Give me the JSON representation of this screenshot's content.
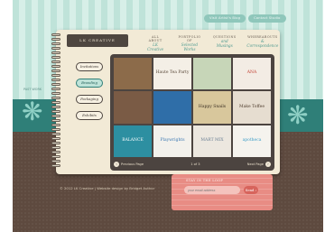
{
  "top_nav": {
    "items": [
      "Visit Artist's Blog",
      "Contact Studio"
    ]
  },
  "brand": {
    "name": "LK CREATIVE"
  },
  "book_nav": [
    {
      "line1": "ALL ABOUT",
      "line2": "LK Creative"
    },
    {
      "line1": "PORTFOLIO OF",
      "line2": "Selected Works"
    },
    {
      "line1": "QUESTIONS",
      "line2": "and Musings"
    },
    {
      "line1": "WHEREABOUTS",
      "line2": "& Correspondence"
    }
  ],
  "side_buttons": [
    {
      "label": "Invitations",
      "active": false
    },
    {
      "label": "Branding",
      "active": true
    },
    {
      "label": "Packaging",
      "active": false
    },
    {
      "label": "Exhibits",
      "active": false
    }
  ],
  "portfolio_tiles": [
    {
      "label": "",
      "bg": "#8c6b4a",
      "fg": "#f1e4cf"
    },
    {
      "label": "Haute Tea Party",
      "bg": "#f4efe6",
      "fg": "#5a4a3a"
    },
    {
      "label": "",
      "bg": "#c7d6b8",
      "fg": "#3f4f33"
    },
    {
      "label": "ANA",
      "bg": "#f3ece4",
      "fg": "#c0392b"
    },
    {
      "label": "",
      "bg": "#7a5b45",
      "fg": "#f4e8d5"
    },
    {
      "label": "",
      "bg": "#2f6ea8",
      "fg": "#ffffff"
    },
    {
      "label": "Happy Snails",
      "bg": "#d8c79c",
      "fg": "#3b2f22"
    },
    {
      "label": "Make Toffee",
      "bg": "#e6ddd0",
      "fg": "#4d3b2b"
    },
    {
      "label": "BALANCE",
      "bg": "#2d8fa1",
      "fg": "#ffffff"
    },
    {
      "label": "Playwrights",
      "bg": "#f3f1ec",
      "fg": "#3a77b2"
    },
    {
      "label": "MART MIX",
      "bg": "#ece7df",
      "fg": "#6a7f93"
    },
    {
      "label": "apotheca",
      "bg": "#f5f3ee",
      "fg": "#3f9fc8"
    }
  ],
  "pager": {
    "prev": "Previous Page",
    "current": "1 of 3",
    "next": "Next Page"
  },
  "footer": {
    "copyright": "© 2012 LK Creative | Website design by Bridget Author"
  },
  "newsletter": {
    "label": "STAY IN THE LOOP",
    "placeholder": "your email address",
    "send": "Send ›"
  },
  "left_label": "PAST WORK",
  "colors": {
    "teal": "#2f7f78",
    "mint": "#bfe3d9",
    "brown": "#5e4a3f",
    "coral": "#e88c84"
  }
}
